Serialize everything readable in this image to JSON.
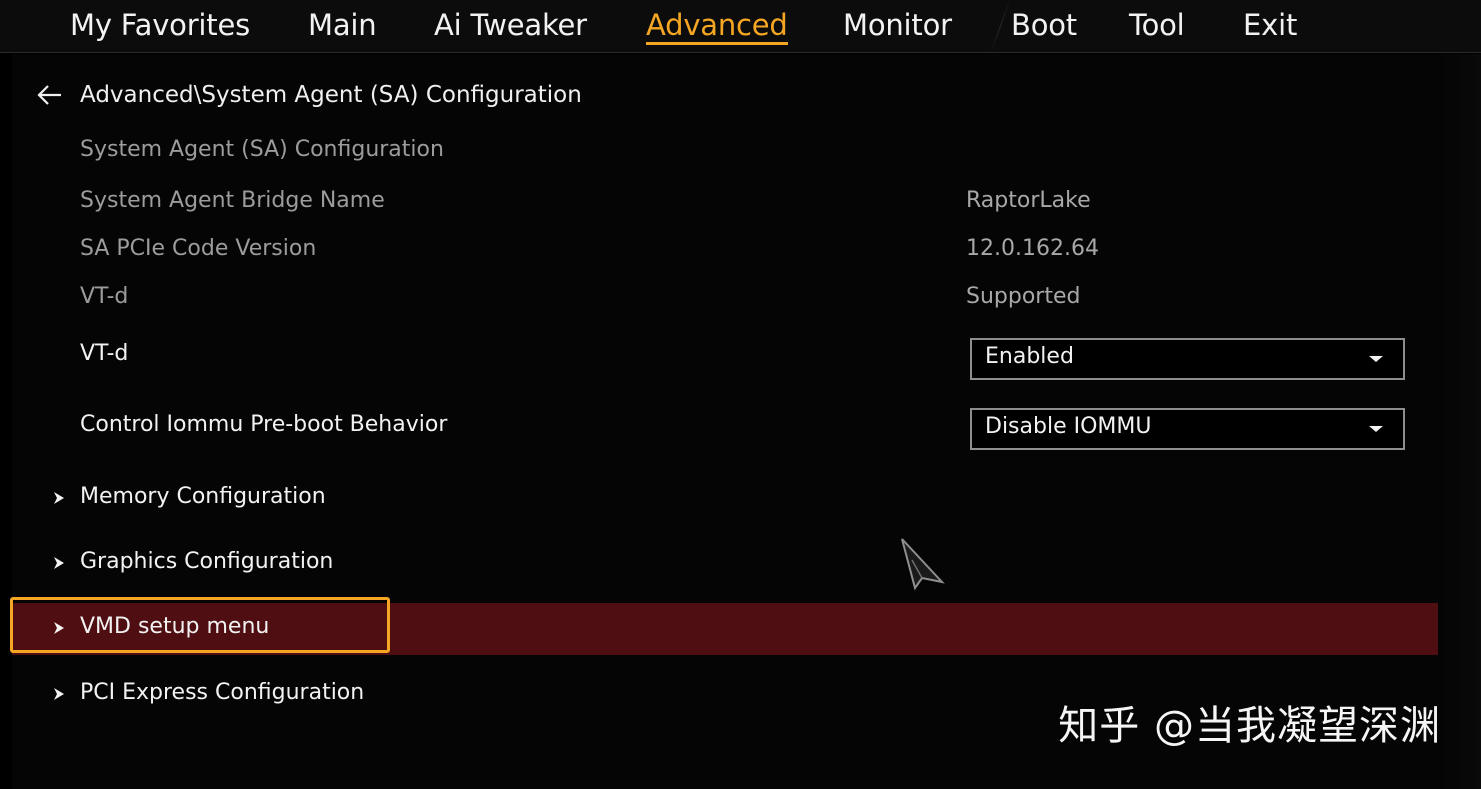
{
  "tabs": [
    {
      "label": "My Favorites",
      "active": false
    },
    {
      "label": "Main",
      "active": false
    },
    {
      "label": "Ai Tweaker",
      "active": false
    },
    {
      "label": "Advanced",
      "active": true
    },
    {
      "label": "Monitor",
      "active": false
    },
    {
      "label": "Boot",
      "active": false
    },
    {
      "label": "Tool",
      "active": false
    },
    {
      "label": "Exit",
      "active": false
    }
  ],
  "breadcrumb": "Advanced\\System Agent (SA) Configuration",
  "section_heading": "System Agent (SA) Configuration",
  "info_rows": [
    {
      "label": "System Agent Bridge Name",
      "value": "RaptorLake"
    },
    {
      "label": "SA PCIe Code Version",
      "value": "12.0.162.64"
    },
    {
      "label": "VT-d",
      "value": "Supported"
    }
  ],
  "settings": [
    {
      "label": "VT-d",
      "value": "Enabled"
    },
    {
      "label": "Control Iommu Pre-boot Behavior",
      "value": "Disable IOMMU"
    }
  ],
  "submenus": [
    {
      "label": "Memory Configuration",
      "selected": false
    },
    {
      "label": "Graphics Configuration",
      "selected": false
    },
    {
      "label": "VMD setup menu",
      "selected": true
    },
    {
      "label": "PCI Express Configuration",
      "selected": false
    }
  ],
  "watermark": "知乎 @当我凝望深渊",
  "colors": {
    "accent": "#f5a623",
    "selected_row": "#4f0e11",
    "background": "#000000"
  },
  "icons": {
    "back": "back-arrow-icon",
    "submenu": "chevron-right-icon",
    "dropdown": "caret-down-icon",
    "pointer": "mouse-pointer-icon"
  }
}
